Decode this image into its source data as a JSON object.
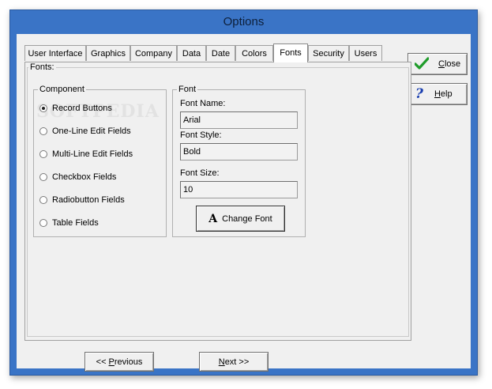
{
  "window": {
    "title": "Options"
  },
  "tabs": [
    {
      "label": "User Interface"
    },
    {
      "label": "Graphics"
    },
    {
      "label": "Company"
    },
    {
      "label": "Data"
    },
    {
      "label": "Date"
    },
    {
      "label": "Colors"
    },
    {
      "label": "Fonts",
      "active": true
    },
    {
      "label": "Security"
    },
    {
      "label": "Users"
    }
  ],
  "fonts_panel": {
    "legend": "Fonts:",
    "component": {
      "legend": "Component",
      "options": [
        {
          "label": "Record Buttons",
          "checked": true
        },
        {
          "label": "One-Line Edit Fields"
        },
        {
          "label": "Multi-Line Edit Fields"
        },
        {
          "label": "Checkbox Fields"
        },
        {
          "label": "Radiobutton Fields"
        },
        {
          "label": "Table Fields"
        }
      ]
    },
    "font": {
      "legend": "Font",
      "name_label": "Font Name:",
      "name_value": "Arial",
      "style_label": "Font Style:",
      "style_value": "Bold",
      "size_label": "Font Size:",
      "size_value": "10",
      "change_button_glyph": "A",
      "change_button_label": "Change Font"
    }
  },
  "side_buttons": {
    "close_label_first": "C",
    "close_label_rest": "lose",
    "help_label_first": "H",
    "help_label_rest": "elp"
  },
  "nav": {
    "previous_prefix": "<< ",
    "previous_first": "P",
    "previous_rest": "revious",
    "next_first": "N",
    "next_rest": "ext >>"
  },
  "watermark": "SOFTPEDIA",
  "colors": {
    "titlebar": "#3a74c6",
    "close_check": "#1f9c2a",
    "help_question": "#1a3fb0"
  }
}
